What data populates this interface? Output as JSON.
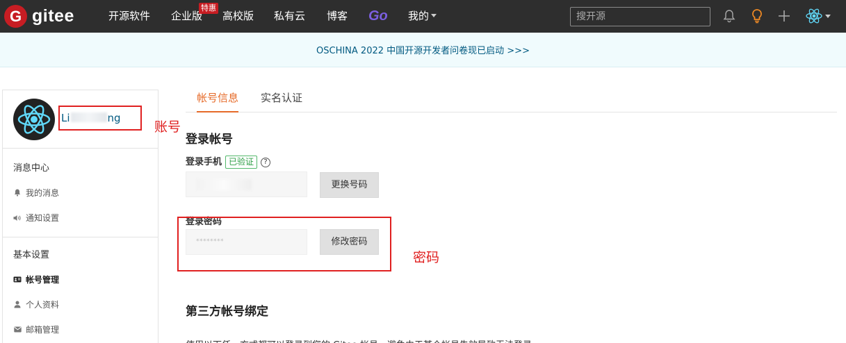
{
  "navbar": {
    "logo_text": "gitee",
    "logo_letter": "G",
    "links": {
      "open_source": "开源软件",
      "enterprise": "企业版",
      "enterprise_badge": "特惠",
      "university": "高校版",
      "private_cloud": "私有云",
      "blog": "博客",
      "go": "Go",
      "mine": "我的"
    },
    "search_placeholder": "搜开源"
  },
  "banner": {
    "text": "OSCHINA 2022 中国开源开发者问卷现已启动 >>>"
  },
  "sidebar": {
    "username_start": "Li",
    "username_end": "ng",
    "sections": [
      {
        "title": "消息中心",
        "items": [
          {
            "label": "我的消息",
            "icon": "bell-icon"
          },
          {
            "label": "通知设置",
            "icon": "speaker-icon"
          }
        ]
      },
      {
        "title": "基本设置",
        "items": [
          {
            "label": "帐号管理",
            "icon": "id-card-icon",
            "active": true
          },
          {
            "label": "个人资料",
            "icon": "user-icon"
          },
          {
            "label": "邮箱管理",
            "icon": "mail-icon"
          }
        ]
      }
    ]
  },
  "tabs": [
    {
      "label": "帐号信息",
      "active": true
    },
    {
      "label": "实名认证",
      "active": false
    }
  ],
  "login_account": {
    "title": "登录帐号",
    "phone_label": "登录手机",
    "verified_badge": "已验证",
    "help_glyph": "?",
    "change_phone_button": "更换号码",
    "password_label": "登录密码",
    "password_mask": "********",
    "change_password_button": "修改密码"
  },
  "third_party": {
    "title": "第三方帐号绑定",
    "description": "使用以下任一方式都可以登录到您的 Gitee 帐号，避免由于某个帐号失效导致无法登录"
  },
  "annotations": {
    "account_label": "账号",
    "password_label": "密码",
    "color": "#e02020"
  },
  "colors": {
    "navbar_bg": "#2e2e2e",
    "brand_red": "#c71d23",
    "tab_active": "#e66a28",
    "link_blue": "#005980",
    "verified_green": "#2d9e45",
    "go_purple": "#7b5fe0"
  }
}
